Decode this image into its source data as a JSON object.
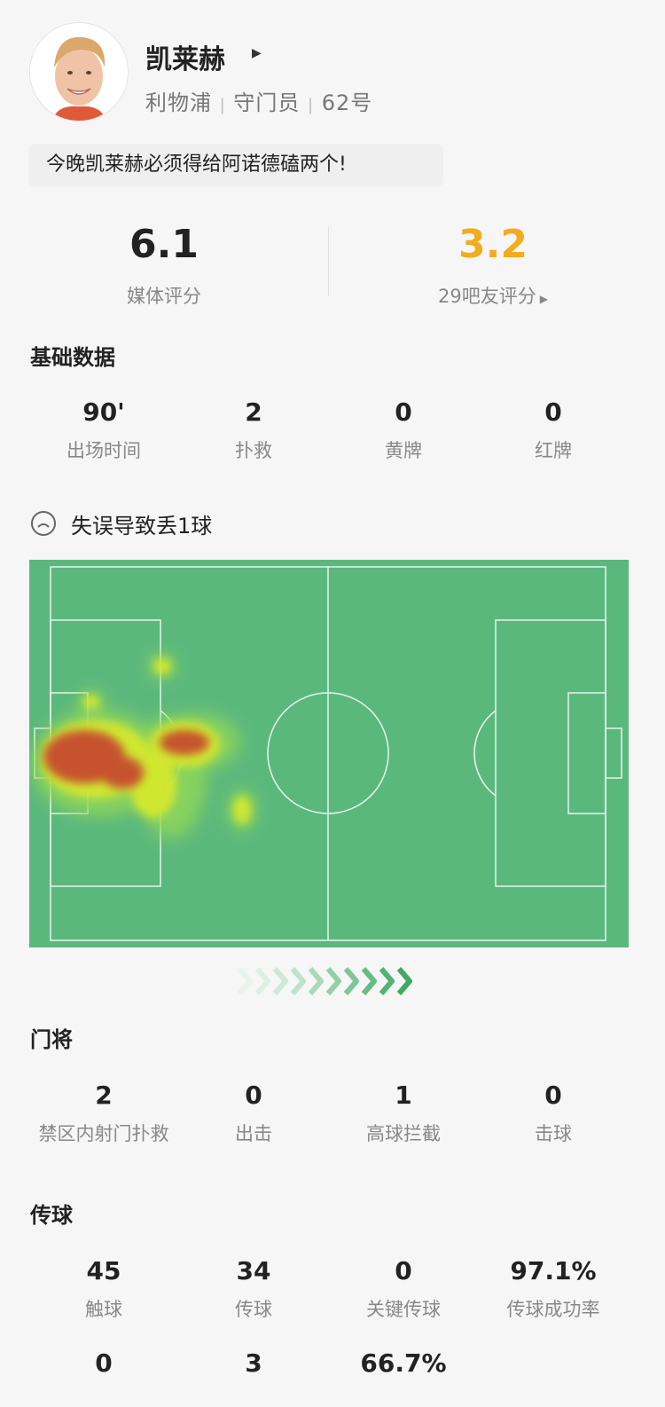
{
  "player": {
    "name": "凯莱赫",
    "team": "利物浦",
    "position": "守门员",
    "number": "62号",
    "quote": "今晚凯莱赫必须得给阿诺德磕两个!"
  },
  "ratings": {
    "media_score": "6.1",
    "media_label": "媒体评分",
    "fan_score": "3.2",
    "fan_label": "29吧友评分"
  },
  "basic": {
    "title": "基础数据",
    "stats": [
      {
        "value": "90'",
        "label": "出场时间"
      },
      {
        "value": "2",
        "label": "扑救"
      },
      {
        "value": "0",
        "label": "黄牌"
      },
      {
        "value": "0",
        "label": "红牌"
      }
    ]
  },
  "notice": "失误导致丢1球",
  "goalkeeping": {
    "title": "门将",
    "stats": [
      {
        "value": "2",
        "label": "禁区内射门扑救"
      },
      {
        "value": "0",
        "label": "出击"
      },
      {
        "value": "1",
        "label": "高球拦截"
      },
      {
        "value": "0",
        "label": "击球"
      }
    ]
  },
  "passing": {
    "title": "传球",
    "stats": [
      {
        "value": "45",
        "label": "触球"
      },
      {
        "value": "34",
        "label": "传球"
      },
      {
        "value": "0",
        "label": "关键传球"
      },
      {
        "value": "97.1%",
        "label": "传球成功率"
      }
    ],
    "stats2": [
      {
        "value": "0"
      },
      {
        "value": "3"
      },
      {
        "value": "66.7%"
      }
    ]
  },
  "colors": {
    "fan_score": "#f3ac1e",
    "pitch": "#5bb87d",
    "heat_hot": "#c6532f",
    "heat_mid": "#e9e21f"
  }
}
